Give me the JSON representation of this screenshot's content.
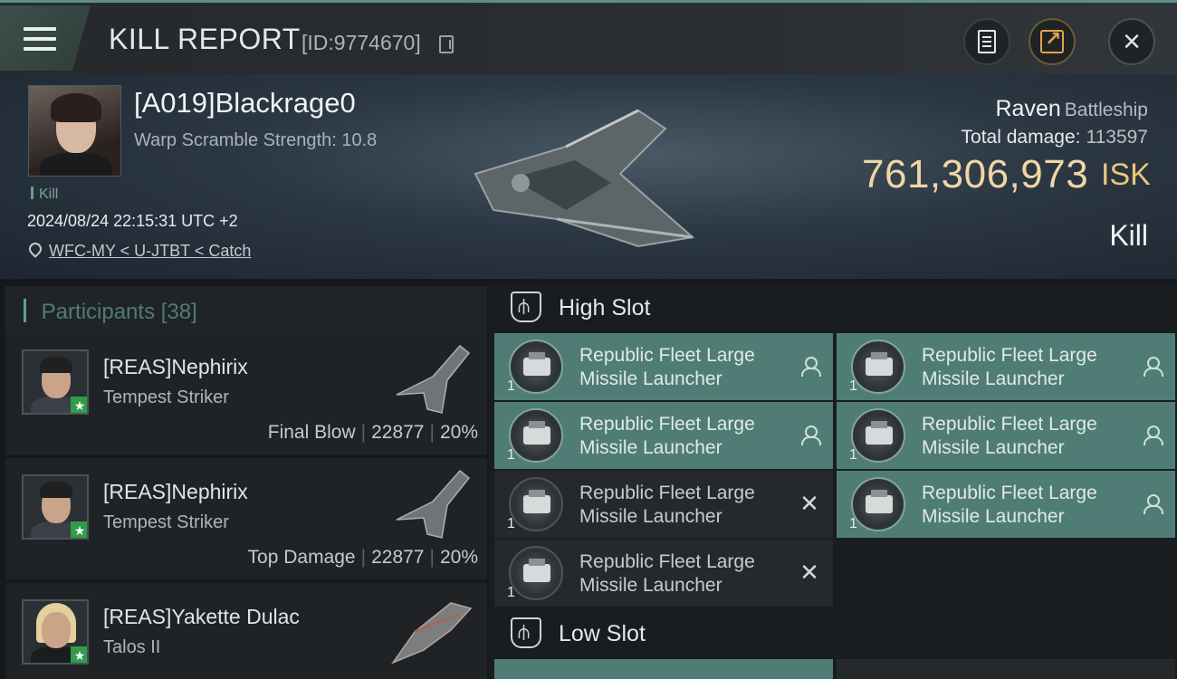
{
  "header": {
    "title": "KILL REPORT",
    "report_id": "[ID:9774670]",
    "icons": [
      "menu-icon",
      "copy-icon",
      "clipboard-icon",
      "share-icon",
      "close-icon"
    ]
  },
  "victim": {
    "name": "[A019]Blackrage0",
    "warp_scramble": "Warp Scramble Strength: 10.8",
    "tag": "Kill",
    "datetime": "2024/08/24 22:15:31 UTC +2",
    "location": "WFC-MY < U-JTBT < Catch",
    "ship_type": "Raven",
    "ship_class": "Battleship",
    "total_damage_label": "Total damage:",
    "total_damage": "113597",
    "isk_value": "761,306,973",
    "isk_unit": "ISK",
    "outcome": "Kill"
  },
  "participants": {
    "title": "Participants",
    "count": "[38]",
    "rows": [
      {
        "name": "[REAS]Nephirix",
        "ship": "Tempest Striker",
        "role": "Final Blow",
        "damage": "22877",
        "percent": "20%"
      },
      {
        "name": "[REAS]Nephirix",
        "ship": "Tempest Striker",
        "role": "Top Damage",
        "damage": "22877",
        "percent": "20%"
      },
      {
        "name": "[REAS]Yakette Dulac",
        "ship": "Talos II"
      }
    ]
  },
  "slots": {
    "high_title": "High Slot",
    "low_title": "Low Slot",
    "high": [
      {
        "line1": "Republic Fleet Large",
        "line2": "Missile Launcher",
        "qty": "1",
        "status": "dropped"
      },
      {
        "line1": "Republic Fleet Large",
        "line2": "Missile Launcher",
        "qty": "1",
        "status": "dropped"
      },
      {
        "line1": "Republic Fleet Large",
        "line2": "Missile Launcher",
        "qty": "1",
        "status": "dropped"
      },
      {
        "line1": "Republic Fleet Large",
        "line2": "Missile Launcher",
        "qty": "1",
        "status": "dropped"
      },
      {
        "line1": "Republic Fleet Large",
        "line2": "Missile Launcher",
        "qty": "1",
        "status": "destroyed"
      },
      {
        "line1": "Republic Fleet Large",
        "line2": "Missile Launcher",
        "qty": "1",
        "status": "dropped"
      },
      {
        "line1": "Republic Fleet Large",
        "line2": "Missile Launcher",
        "qty": "1",
        "status": "destroyed"
      }
    ]
  }
}
